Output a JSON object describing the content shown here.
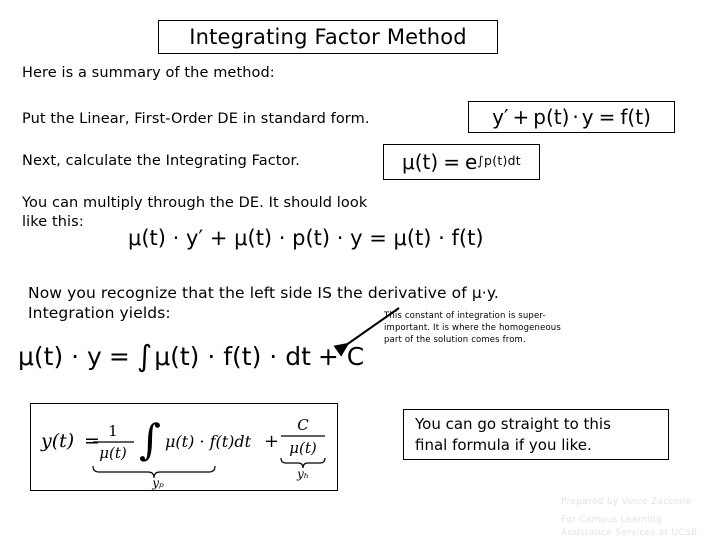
{
  "slide": {
    "title": "Integrating Factor Method",
    "intro": "Here is a summary of the method:",
    "step_standard_form": "Put the Linear, First-Order DE in standard form.",
    "step_next": "Next, calculate the Integrating Factor.",
    "step_multiply": "You can multiply through the DE.  It should look\nlike this:",
    "step_recognize": "Now you recognize that the left side IS the derivative of μ·y.\nIntegration yields:"
  },
  "formulas": {
    "standard_form": {
      "y_prime": "y′",
      "plus": "+",
      "p_of_t": "p(t)",
      "dot1": "·",
      "y": "y",
      "equals": "=",
      "f_of_t": "f(t)",
      "plain": "y′ + p(t) · y = f(t)"
    },
    "integrating_factor": {
      "mu_of_t": "μ(t)",
      "equals": "=",
      "base_e": "e",
      "exponent": "∫p(t)dt",
      "plain": "μ(t) = e^∫p(t)dt"
    },
    "multiplied": {
      "plain": "μ(t) · y′ + μ(t) · p(t) · y = μ(t) · f(t)",
      "lhs_term1": "μ(t) · y′",
      "lhs_term2": "μ(t) · p(t) · y",
      "rhs": "μ(t) · f(t)"
    },
    "integrated": {
      "lhs": "μ(t) · y",
      "equals": "=",
      "integral": "∫",
      "integrand": "μ(t) · f(t) · dt",
      "plus_c": "+ C",
      "plain": "μ(t) · y = ∫μ(t) · f(t) · dt + C"
    },
    "final_solution": {
      "lhs": "y(t)",
      "equals": "=",
      "fraction_one": "1",
      "fraction_mu": "μ(t)",
      "integral": "∫",
      "integrand": "μ(t) · f(t)dt",
      "plus": "+",
      "c_numerator": "C",
      "c_denominator": "μ(t)",
      "brace_label_particular": "yₚ",
      "brace_label_homogeneous": "yₕ",
      "plain": "y(t) = (1/μ(t)) ∫ μ(t) · f(t)dt + C/μ(t)"
    }
  },
  "annotation": {
    "constant_note": "This constant of integration is super-\nimportant.   It is where the homogeneous\npart of the solution comes from."
  },
  "callout": {
    "text": "You can go straight to this\nfinal formula if you like."
  },
  "credit": {
    "prepared_by": "Prepared by Vince Zaccone",
    "organization": "For Campus Learning\nAssistance Services at UCSB"
  },
  "colors": {
    "background": "#ffffff",
    "text": "#000000",
    "border": "#000000",
    "credit_text": "#e3e3e3"
  }
}
